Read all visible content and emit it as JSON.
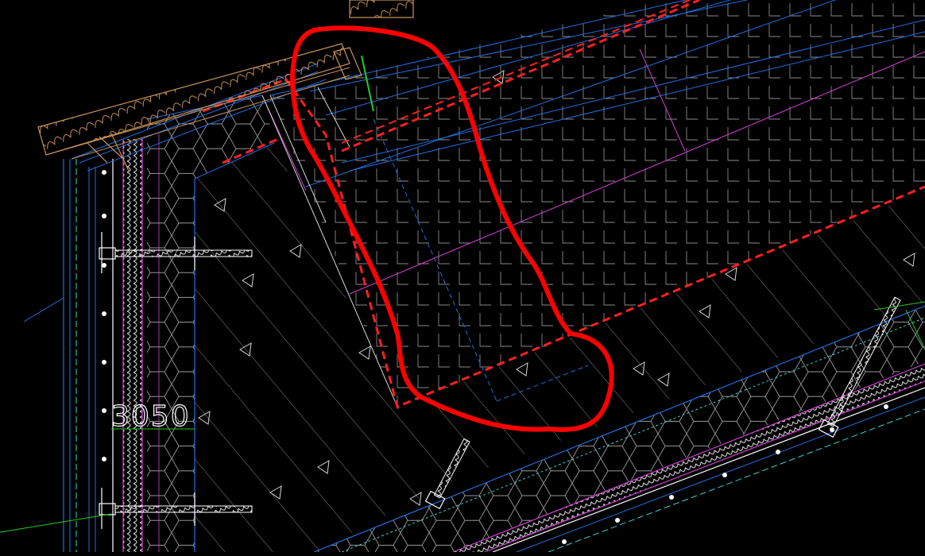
{
  "drawing": {
    "background": "#000000",
    "dimension_text": "3050",
    "colors": {
      "cad_white": "#d9d9d9",
      "cad_blue": "#1f6fe0",
      "cad_cyan": "#3fd0d0",
      "cad_magenta": "#d23fd2",
      "cad_red": "#ff1f1f",
      "cad_green": "#22cc22",
      "cad_orange": "#c8915a",
      "markup_red": "#ff0000"
    }
  }
}
